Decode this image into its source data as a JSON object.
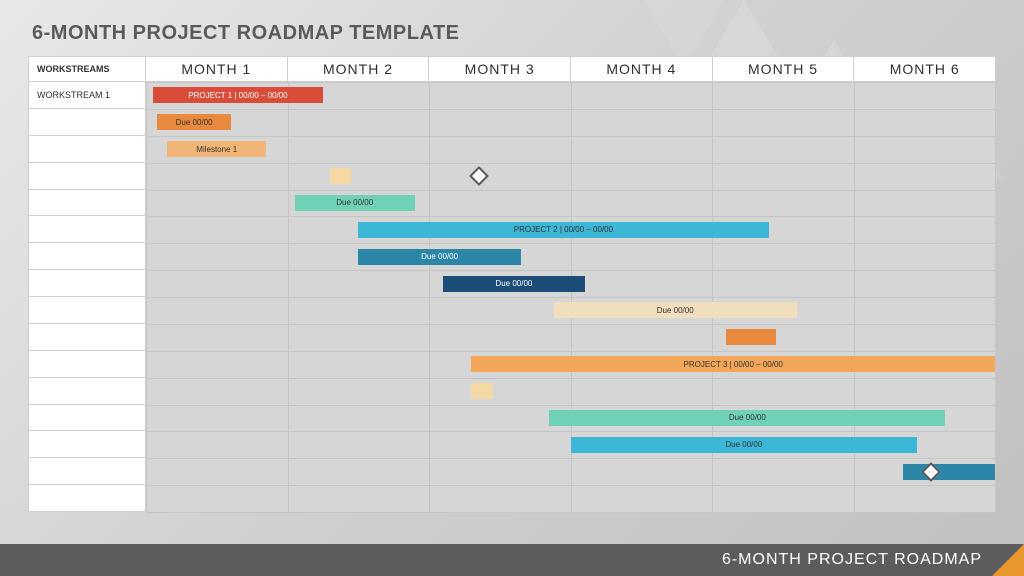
{
  "title": "6-MONTH PROJECT ROADMAP TEMPLATE",
  "footer": "6-MONTH PROJECT ROADMAP",
  "header": {
    "side": "WORKSTREAMS",
    "months": [
      "MONTH 1",
      "MONTH 2",
      "MONTH 3",
      "MONTH 4",
      "MONTH 5",
      "MONTH 6"
    ]
  },
  "side_labels": [
    "WORKSTREAM 1",
    "",
    "",
    "",
    "",
    "",
    "",
    "",
    "",
    "",
    "",
    "",
    "",
    "",
    "",
    ""
  ],
  "chart_data": {
    "type": "bar",
    "x_range_months": 6,
    "rows": 16,
    "items": [
      {
        "row": 0,
        "start": 0.05,
        "end": 1.25,
        "label": "PROJECT 1   |   00/00 – 00/00",
        "color": "#d94c3a",
        "text": "white"
      },
      {
        "row": 1,
        "start": 0.08,
        "end": 0.6,
        "label": "Due 00/00",
        "color": "#e9893e",
        "text": "dark"
      },
      {
        "row": 2,
        "start": 0.15,
        "end": 0.85,
        "label": "Milestone 1",
        "color": "#f1b675",
        "text": "dark"
      },
      {
        "row": 3,
        "start": 1.3,
        "end": 1.45,
        "label": "",
        "color": "#f4d9a5",
        "text": "dark"
      },
      {
        "row": 4,
        "start": 1.05,
        "end": 1.9,
        "label": "Due 00/00",
        "color": "#6fd1b5",
        "text": "dark"
      },
      {
        "row": 5,
        "start": 1.5,
        "end": 4.4,
        "label": "PROJECT 2   |   00/00 – 00/00",
        "color": "#3db7d6",
        "text": "dark"
      },
      {
        "row": 6,
        "start": 1.5,
        "end": 2.65,
        "label": "Due 00/00",
        "color": "#2b86a8",
        "text": "white"
      },
      {
        "row": 7,
        "start": 2.1,
        "end": 3.1,
        "label": "Due 00/00",
        "color": "#1c4c78",
        "text": "white"
      },
      {
        "row": 8,
        "start": 2.88,
        "end": 4.6,
        "label": "Due 00/00",
        "color": "#f0debd",
        "text": "dark"
      },
      {
        "row": 9,
        "start": 4.1,
        "end": 4.45,
        "label": "",
        "color": "#e9893e",
        "text": "dark"
      },
      {
        "row": 10,
        "start": 2.3,
        "end": 6.0,
        "label": "PROJECT 3   |   00/00 – 00/00",
        "color": "#f2a65a",
        "text": "dark"
      },
      {
        "row": 11,
        "start": 2.3,
        "end": 2.45,
        "label": "",
        "color": "#f4d9a5",
        "text": "dark"
      },
      {
        "row": 12,
        "start": 2.85,
        "end": 5.65,
        "label": "Due 00/00",
        "color": "#6fd1b5",
        "text": "dark"
      },
      {
        "row": 13,
        "start": 3.0,
        "end": 5.45,
        "label": "Due 00/00",
        "color": "#3db7d6",
        "text": "dark"
      },
      {
        "row": 14,
        "start": 5.35,
        "end": 6.0,
        "label": "",
        "color": "#2b86a8",
        "text": "white"
      }
    ],
    "diamonds": [
      {
        "row": 3,
        "x": 2.35
      },
      {
        "row": 14,
        "x": 5.55
      }
    ]
  }
}
